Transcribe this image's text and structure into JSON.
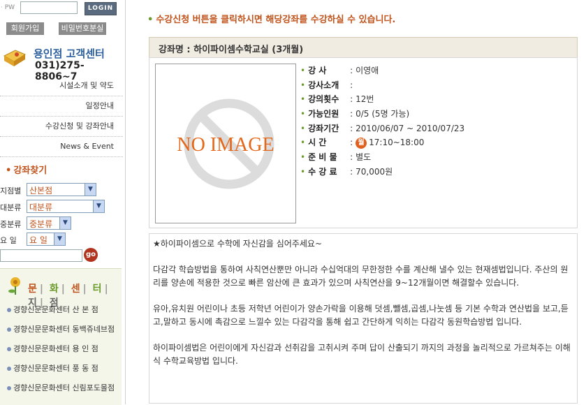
{
  "login": {
    "pw_label": "PW",
    "login_button": "LOGIN",
    "join_button": "회원가입",
    "find_pw_button": "비밀번호분실"
  },
  "customer_center": {
    "title": "용인점 고객센터",
    "phone": "031)275-8806~7"
  },
  "side_links": [
    "시설소개 및 약도",
    "일정안내",
    "수강신청 및 강좌안내",
    "News & Event"
  ],
  "search": {
    "title": "강좌찾기",
    "filters": [
      {
        "label": "지점별",
        "value": "산본점"
      },
      {
        "label": "대분류",
        "value": "대분류"
      },
      {
        "label": "중분류",
        "value": "중분류"
      },
      {
        "label": "요 일",
        "value": "요 일"
      }
    ],
    "go_button": "go"
  },
  "culture": {
    "title_chars": [
      "문",
      "화",
      "센",
      "터",
      "지",
      "점"
    ],
    "title_colors": [
      "#c0531c",
      "#6a9a2a",
      "#c0531c",
      "#6a9a2a",
      "#666666",
      "#666666"
    ],
    "items": [
      "경향신문문화센터 산 본 점",
      "경향신문문화센터 동백쥬네브점",
      "경향신문문화센터 용 인 점",
      "경향신문문화센터 풍 동 점",
      "경향신문문화센터 신림포도몰점"
    ]
  },
  "main": {
    "notice": "수강신청 버튼을 클릭하시면 해당강좌를 수강하실 수 있습니다.",
    "course_title": "강좌명 : 하이파이셈수학교실 (3개월)",
    "no_image": "NO IMAGE",
    "info": [
      {
        "label": "강 사",
        "value": "이영애"
      },
      {
        "label": "강사소개",
        "value": ""
      },
      {
        "label": "강의횟수",
        "value": "12번"
      },
      {
        "label": "가능인원",
        "value": "0/5 (5명 가능)"
      },
      {
        "label": "강좌기간",
        "value": "2010/06/07 ~ 2010/07/23"
      },
      {
        "label": "시 간",
        "day": "월",
        "value": "17:10~18:00"
      },
      {
        "label": "준 비 물",
        "value": "별도"
      },
      {
        "label": "수 강 료",
        "value": "70,000원"
      }
    ],
    "description": [
      "★하이파이셈으로 수학에 자신감을 심어주세요~",
      "다감각 학습방법을 통하여 사칙연산뿐만 아니라 수십억대의 무한정한 수를 계산해 낼수 있는 현재셈법입니다. 주산의 원리를 양손에 적용한 것으로 빠른 암산에 큰 효과가 있으며 사칙연산을 9~12개월이면 해결할수 있습니다.",
      "유아,유치원 어린이나 초등 저학년 어린이가 양손가락을 이용해 덧셈,뺄셈,곱셈,나눗셈 등 기본 수학과 연산법을 보고,듣고,말하고 동시에 촉감으로 느낄수 있는 다감각을 통해 쉽고 간단하게 익히는 다감각 동원학습방법 입니다.",
      "하이파이셈법은 어린이에게 자신감과 선취감을 고취시켜 주며 답이 산출되기 까지의 과정을 놀리적으로 가르쳐주는 이해식 수학교육방법 입니다."
    ]
  },
  "colors": {
    "accent_orange": "#c0531c",
    "green_dot": "#6a9a2a",
    "header_bg": "#f1ece1"
  }
}
